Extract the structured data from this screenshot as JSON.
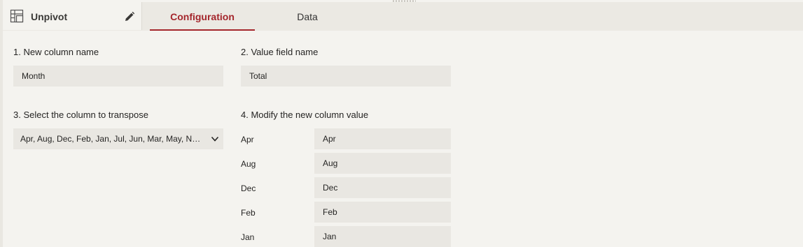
{
  "header": {
    "title": "Unpivot",
    "tabs": [
      {
        "label": "Configuration",
        "active": true
      },
      {
        "label": "Data",
        "active": false
      }
    ]
  },
  "config": {
    "new_column_label": "1. New column name",
    "new_column_value": "Month",
    "value_field_label": "2. Value field name",
    "value_field_value": "Total",
    "transpose_label": "3. Select the column to transpose",
    "transpose_value": "Apr, Aug, Dec, Feb, Jan, Jul, Jun, Mar, May, Nov, Oct, Sep",
    "modify_label": "4. Modify the new column value",
    "rows": [
      {
        "original": "Apr",
        "new_value": "Apr"
      },
      {
        "original": "Aug",
        "new_value": "Aug"
      },
      {
        "original": "Dec",
        "new_value": "Dec"
      },
      {
        "original": "Feb",
        "new_value": "Feb"
      },
      {
        "original": "Jan",
        "new_value": "Jan"
      }
    ]
  },
  "colors": {
    "accent": "#a4262c",
    "background": "#f4f3ef",
    "field": "#e9e7e2"
  },
  "icons": {
    "title": "table-transform-icon",
    "edit": "pencil-icon",
    "dropdown": "chevron-down-icon"
  }
}
